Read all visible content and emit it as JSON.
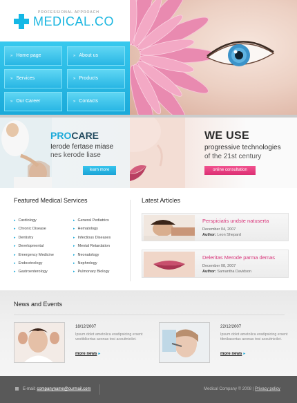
{
  "logo": {
    "tagline": "PROFESSIONAL APPROACH",
    "name_part1": "MEDICAL",
    "name_part2": ".CO"
  },
  "nav": {
    "items": [
      {
        "label": "Home page"
      },
      {
        "label": "About us"
      },
      {
        "label": "Services"
      },
      {
        "label": "Products"
      },
      {
        "label": "Our Career"
      },
      {
        "label": "Contacts"
      }
    ]
  },
  "promo_left": {
    "title_accent": "PRO",
    "title_rest": "CARE",
    "line1": "Ierode fertase miase",
    "line2": "nes kerode liase",
    "button_label": "learn more"
  },
  "promo_right": {
    "title": "WE USE",
    "line1": "progressive technologies",
    "line2": "of the 21st century",
    "button_label": "online consultation"
  },
  "services": {
    "title": "Featured Medical Services",
    "col1": [
      "Cardiology",
      "Chronic Disease",
      "Dentistry",
      "Developmental",
      "Emergency Medicine",
      "Endocrinology",
      "Gastroenterology"
    ],
    "col2": [
      "General Pediatrics",
      "Hematology",
      "Infectious Diseases",
      "Mental Retardation",
      "Neonatology",
      "Nephrology",
      "Pulmonary Biology"
    ]
  },
  "articles": {
    "title": "Latest Articles",
    "items": [
      {
        "title": "Perspiciatis undste natuserta",
        "date": "December 04, 2007",
        "author_label": "Author:",
        "author": "Leon Shepard"
      },
      {
        "title": "Deleritas Merode parma demas",
        "date": "December 08, 2007",
        "author_label": "Author:",
        "author": "Samantha Davidson"
      }
    ]
  },
  "news": {
    "title": "News and Events",
    "items": [
      {
        "date": "18/12/2007",
        "text": "Ipsum dolot ametolica eradipsicing ersent vestiblkertas aeonas tosi aceuitnicilet.",
        "more": "more news"
      },
      {
        "date": "22/12/2007",
        "text": "Ipsum dolot ametolica eradipsicing ersent tibnikasertas aeonas tosi aceuitnicilet.",
        "more": "more news"
      }
    ]
  },
  "footer": {
    "email_label": "E-mail:",
    "email": "companyname@ourmail.com",
    "copyright": "Medical Company © 2008",
    "separator": "|",
    "privacy": "Privacy policy"
  },
  "colors": {
    "accent": "#1aa9d9",
    "pink": "#d8357a",
    "footer": "#595959"
  }
}
